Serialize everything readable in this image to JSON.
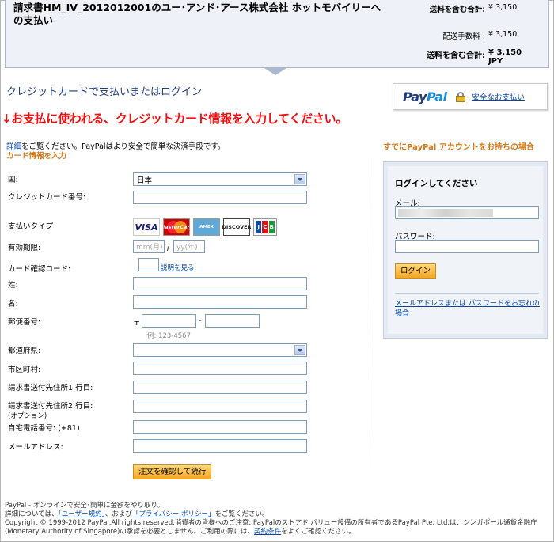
{
  "order": {
    "title": "請求書HM_IV_2012012001のユー･アンド･アース株式会社  ホットモバイリーへの支払い",
    "subtotal_label": "送料を含む合計:",
    "subtotal_value": "¥ 3,150",
    "fee_label": "配送手数料 :",
    "fee_value": "¥ 3,150",
    "total_label": "送料を含む合計:",
    "total_value": "¥ 3,150  JPY"
  },
  "header": {
    "heading": "クレジットカードで支払いまたはログイン",
    "paypal_logo_1": "Pay",
    "paypal_logo_2": "Pal",
    "secure_link": "安全なお支払い",
    "annotation": "↓お支払に使われる、クレジットカード情報を入力してください。",
    "intro_link": "詳細",
    "intro_text": "をご覧ください。PayPalはより安全で簡単な決済手段です。",
    "card_heading": "カード情報を入力",
    "existing_heading": "すでにPayPal アカウントをお持ちの場合"
  },
  "form": {
    "country_label": "国:",
    "country_value": "日本",
    "card_number_label": "クレジットカード番号:",
    "payment_type_label": "支払いタイプ",
    "cards": [
      "VISA",
      "MasterCard",
      "AMEX",
      "DISCOVER",
      "JCB"
    ],
    "expiry_label": "有効期限:",
    "expiry_month_placeholder": "mm(月)",
    "expiry_slash": "/",
    "expiry_year_placeholder": "yy(年)",
    "cvv_label": "カード確認コード:",
    "cvv_help": "説明を見る",
    "last_name_label": "姓:",
    "first_name_label": "名:",
    "zip_label": "郵便番号:",
    "zip_mark": "〒",
    "zip_dash": "-",
    "zip_hint": "例: 123-4567",
    "prefecture_label": "都道府県:",
    "city_label": "市区町村:",
    "address1_label": "請求書送付先住所1 行目:",
    "address2_label": "請求書送付先住所2 行目:",
    "address2_sub": "(オプション)",
    "phone_label": "自宅電話番号: (+81)",
    "email_label": "メールアドレス:",
    "submit": "注文を確認して続行"
  },
  "login": {
    "title": "ログインしてください",
    "email_label": "メール:",
    "password_label": "パスワード:",
    "button": "ログイン",
    "forgot": "メールアドレスまたは パスワードをお忘れの場合"
  },
  "footer": {
    "line1": "PayPal - オンラインで安全･簡単に金額をやり取り。",
    "line2_pre": "詳細については、",
    "terms": "「ユーザー規約」",
    "line2_mid": "、および",
    "privacy": "「プライバシー ポリシー」",
    "line2_post": "をご覧ください。",
    "line3": "Copyright © 1999-2012 PayPal.All rights reserved.消費者の皆様へのご注意: PayPalのストアド バリュー設備の所有者であるPayPal Pte. Ltd.は、シンガポール通貨金融庁(Monetary Authority of Singapore)の承認を必要としません。ご利用の際には、",
    "conditions": "契約条件",
    "line3_post": "をよくご確認ください。"
  }
}
